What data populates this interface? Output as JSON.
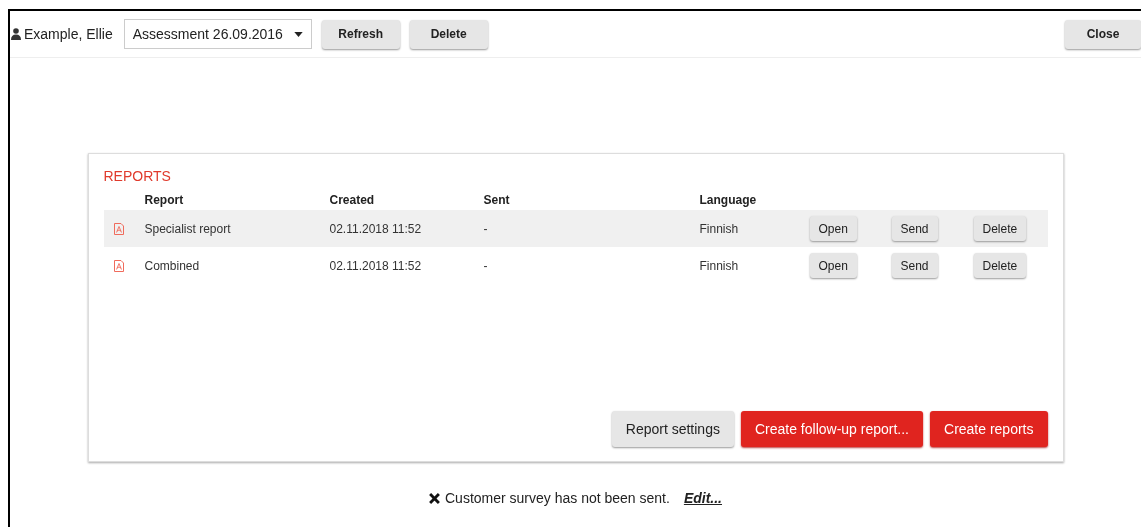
{
  "header": {
    "person": "Example, Ellie",
    "assessment": {
      "value": "Assessment 26.09.2016"
    },
    "buttons": [
      "Refresh",
      "Delete"
    ],
    "close": "Close"
  },
  "reports": {
    "title": "REPORTS",
    "columns": [
      "Report",
      "Created",
      "Sent",
      "Language"
    ],
    "rows": [
      {
        "name": "Specialist report",
        "created": "02.11.2018 11:52",
        "sent": "-",
        "language": "Finnish",
        "selected": true,
        "actions": [
          "Open",
          "Send",
          "Delete"
        ]
      },
      {
        "name": "Combined",
        "created": "02.11.2018 11:52",
        "sent": "-",
        "language": "Finnish",
        "selected": false,
        "actions": [
          "Open",
          "Send",
          "Delete"
        ]
      }
    ],
    "buttons": [
      {
        "label": "Report settings",
        "kind": "secondary"
      },
      {
        "label": "Create follow-up report...",
        "kind": "primary"
      },
      {
        "label": "Create reports",
        "kind": "primary"
      }
    ]
  },
  "survey": {
    "text": "Customer survey has not been sent.",
    "link": "Edit..."
  }
}
